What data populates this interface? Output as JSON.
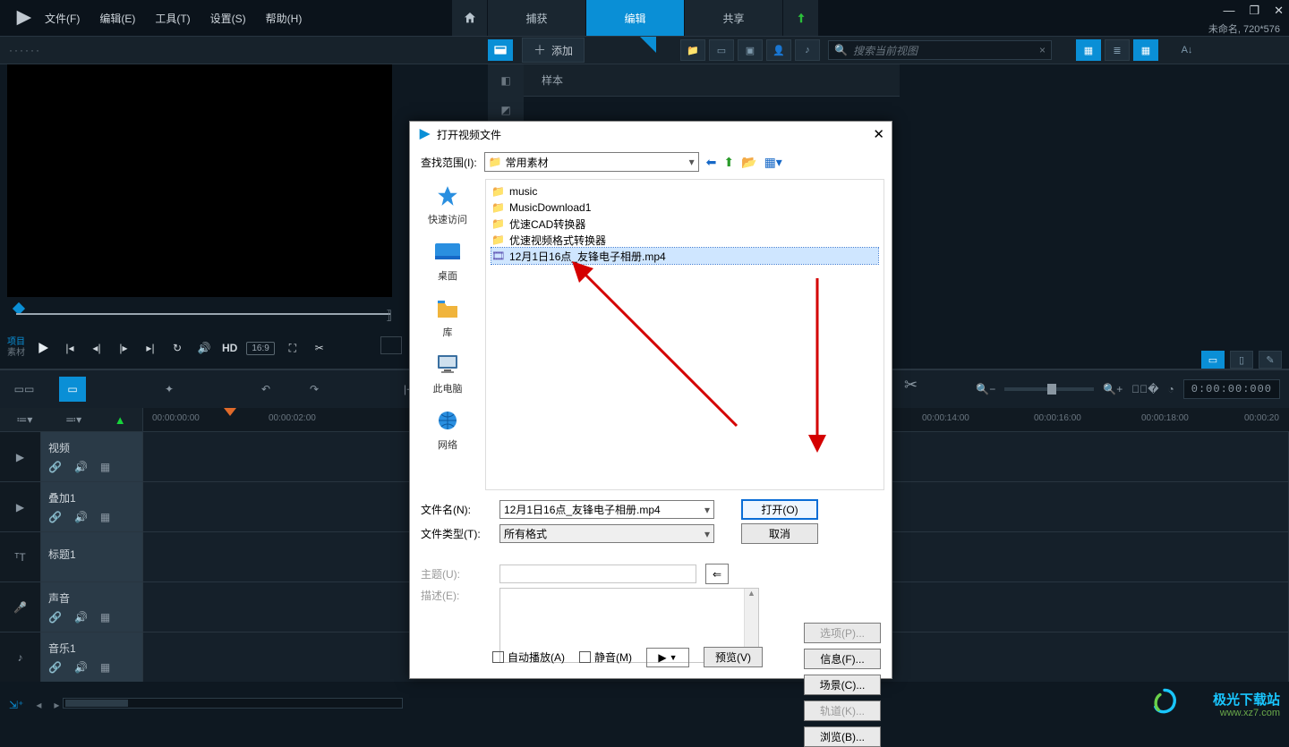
{
  "menu": {
    "file": "文件(F)",
    "edit": "编辑(E)",
    "tools": "工具(T)",
    "settings": "设置(S)",
    "help": "帮助(H)"
  },
  "tabs": {
    "capture": "捕获",
    "edit": "编辑",
    "share": "共享"
  },
  "project_info": "未命名, 720*576",
  "toolbar": {
    "add": "添加",
    "sample": "样本",
    "search_placeholder": "搜索当前视图"
  },
  "transport": {
    "project": "项目",
    "material": "素材",
    "hd": "HD",
    "aspect": "16:9"
  },
  "ruler": {
    "t0": "00:00:00:00",
    "t2": "00:00:02:00",
    "t14": "00:00:14:00",
    "t16": "00:00:16:00",
    "t18": "00:00:18:00",
    "t20": "00:00:20"
  },
  "timecode": "0:00:00:000",
  "tracks": {
    "video": "视频",
    "overlay": "叠加1",
    "title": "标题1",
    "voice": "声音",
    "music": "音乐1"
  },
  "dialog": {
    "title": "打开视频文件",
    "look_label": "查找范围(I):",
    "look_value": "常用素材",
    "places": {
      "quick": "快速访问",
      "desktop": "桌面",
      "lib": "库",
      "pc": "此电脑",
      "net": "网络"
    },
    "files": {
      "music": "music",
      "music_dl": "MusicDownload1",
      "cad": "优速CAD转换器",
      "vid": "优速视频格式转换器",
      "selected": "12月1日16点_友锋电子相册.mp4"
    },
    "filename_label": "文件名(N):",
    "filename_value": "12月1日16点_友锋电子相册.mp4",
    "filetype_label": "文件类型(T):",
    "filetype_value": "所有格式",
    "open": "打开(O)",
    "cancel": "取消",
    "subject_label": "主题(U):",
    "desc_label": "描述(E):",
    "options": "选项(P)...",
    "info": "信息(F)...",
    "scene": "场景(C)...",
    "track": "轨道(K)...",
    "browse": "浏览(B)...",
    "autoplay": "自动播放(A)",
    "mute": "静音(M)",
    "preview": "预览(V)"
  },
  "watermark": {
    "t1": "极光下载站",
    "t2": "www.xz7.com"
  }
}
